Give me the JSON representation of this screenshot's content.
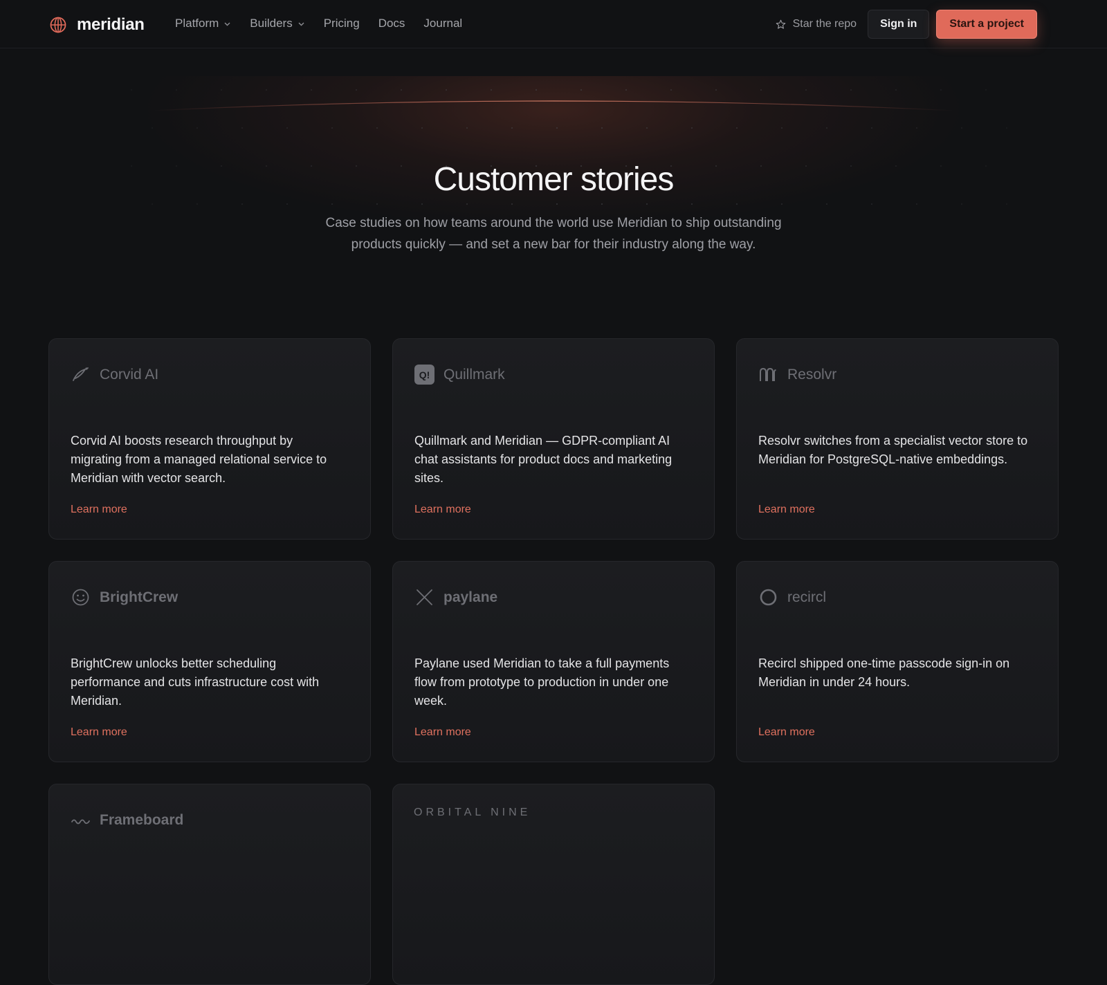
{
  "nav": {
    "brand": "meridian",
    "links": [
      {
        "label": "Platform",
        "dropdown": true
      },
      {
        "label": "Builders",
        "dropdown": true
      },
      {
        "label": "Pricing",
        "dropdown": false
      },
      {
        "label": "Docs",
        "dropdown": false
      },
      {
        "label": "Journal",
        "dropdown": false
      }
    ],
    "star_label": "Star the repo",
    "signin_label": "Sign in",
    "cta_label": "Start a project"
  },
  "hero": {
    "title": "Customer stories",
    "subtitle": "Case studies on how teams around the world use Meridian to ship outstanding products quickly — and set a new bar for their industry along the way."
  },
  "stories": [
    {
      "brand": "Corvid AI",
      "icon": "bird-icon",
      "desc": "Corvid AI boosts research throughput by migrating from a managed relational service to Meridian with vector search.",
      "link": "Learn more"
    },
    {
      "brand": "Quillmark",
      "icon": "q-badge-icon",
      "desc": "Quillmark and Meridian — GDPR-compliant AI chat assistants for product docs and marketing sites.",
      "link": "Learn more"
    },
    {
      "brand": "Resolvr",
      "icon": "arches-icon",
      "desc": "Resolvr switches from a specialist vector store to Meridian for PostgreSQL-native embeddings.",
      "link": "Learn more"
    },
    {
      "brand": "BrightCrew",
      "icon": "smiley-icon",
      "desc": "BrightCrew unlocks better scheduling performance and cuts infrastructure cost with Meridian.",
      "link": "Learn more"
    },
    {
      "brand": "paylane",
      "icon": "x-mark-icon",
      "desc": "Paylane used Meridian to take a full payments flow from prototype to production in under one week.",
      "link": "Learn more"
    },
    {
      "brand": "recircl",
      "icon": "ring-icon",
      "desc": "Recircl shipped one-time passcode sign-in on Meridian in under 24 hours.",
      "link": "Learn more"
    },
    {
      "brand": "Frameboard",
      "icon": "wave-icon",
      "desc": "",
      "link": ""
    },
    {
      "brand": "ORBITAL NINE",
      "icon": "",
      "desc": "",
      "link": ""
    }
  ],
  "colors": {
    "background": "#111214",
    "accent": "#e06a5a",
    "link": "#e0715f",
    "card": "#1a1b1e"
  }
}
